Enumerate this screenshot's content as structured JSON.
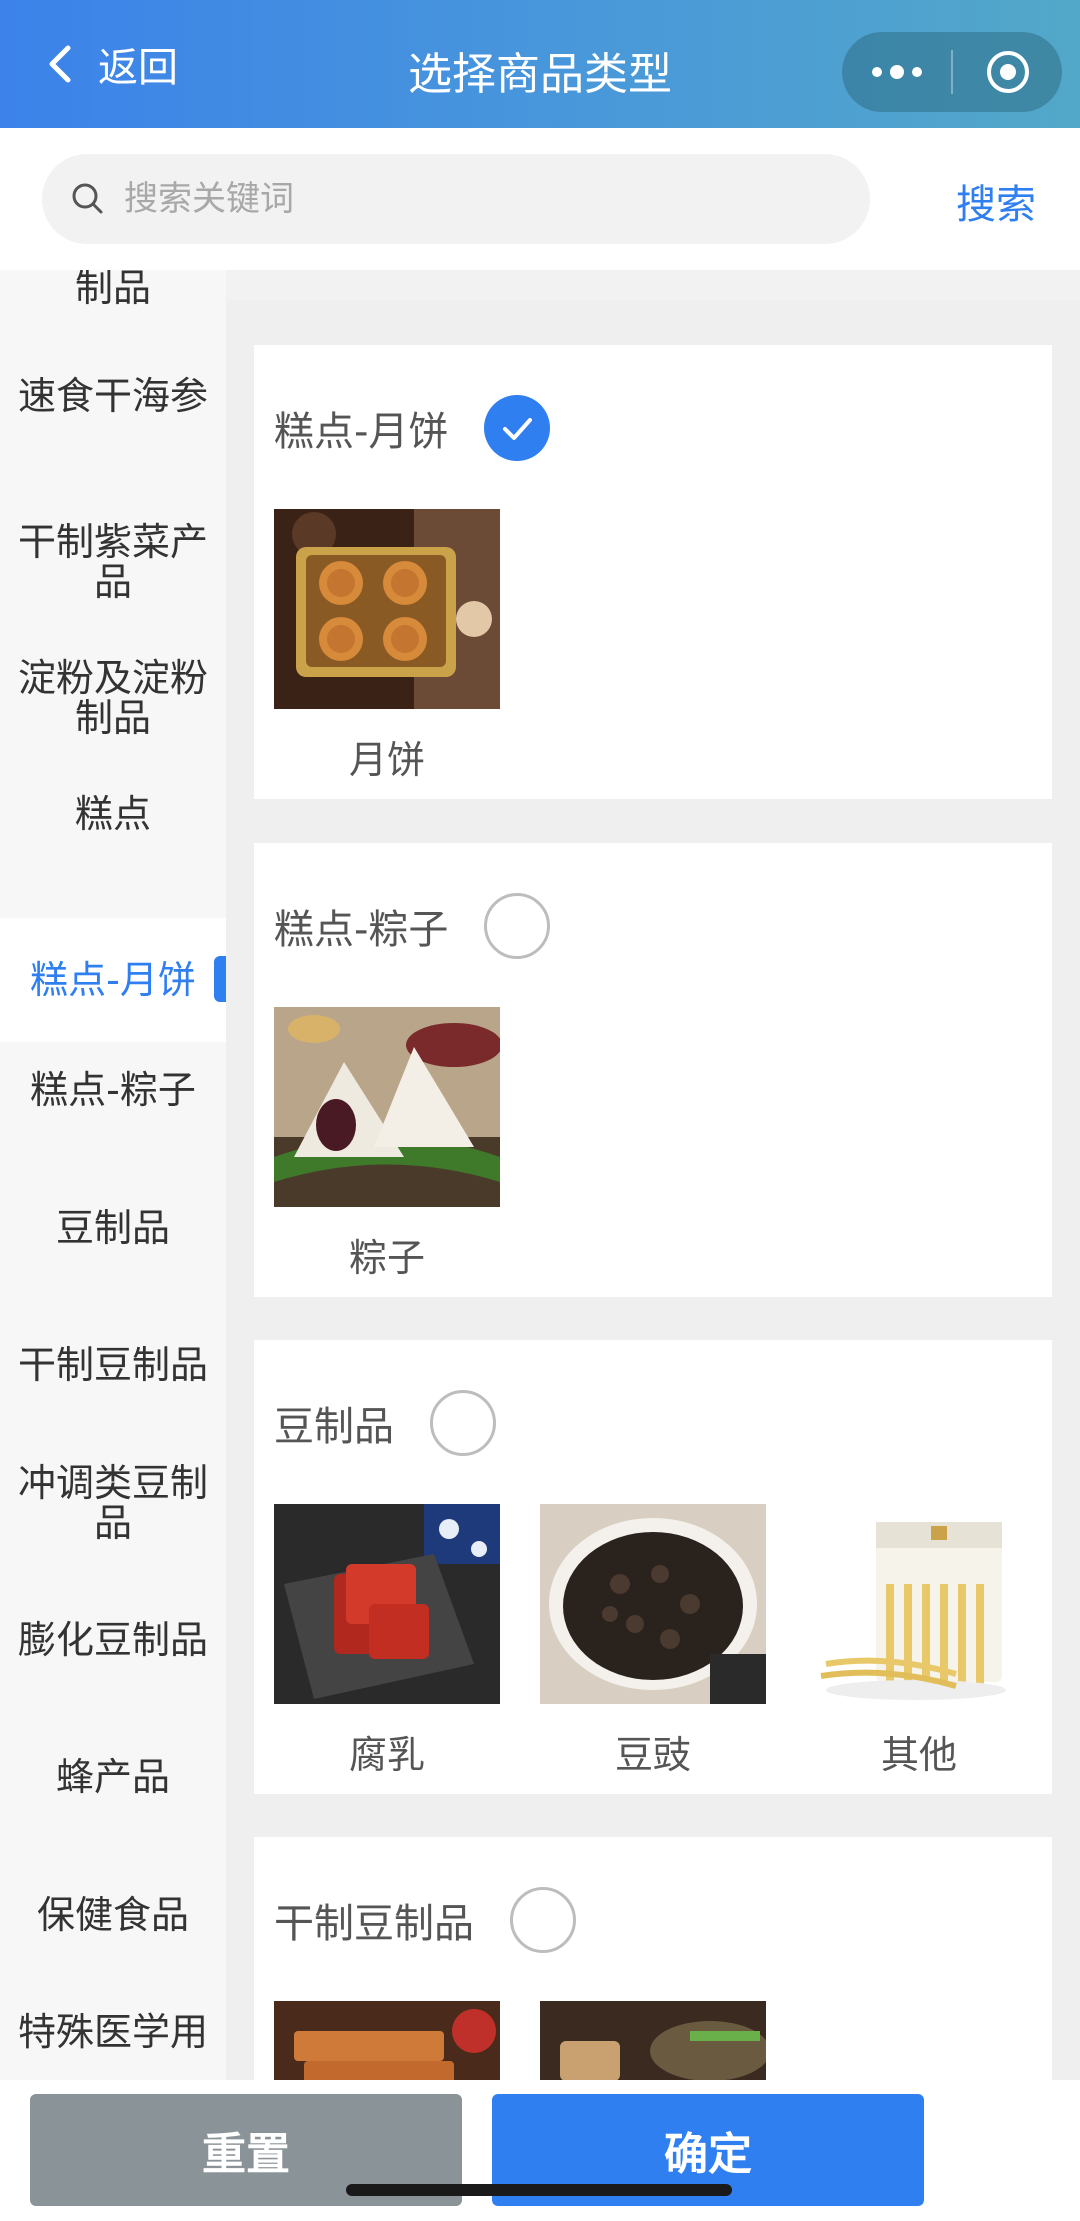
{
  "navbar": {
    "back_label": "返回",
    "title": "选择商品类型"
  },
  "search": {
    "placeholder": "搜索关键词",
    "button_label": "搜索"
  },
  "sidebar": {
    "items": [
      {
        "label": "制品",
        "active": false
      },
      {
        "label": "速食干海参",
        "active": false
      },
      {
        "label": "干制紫菜产品",
        "active": false
      },
      {
        "label": "淀粉及淀粉制品",
        "active": false
      },
      {
        "label": "糕点",
        "active": false
      },
      {
        "label": "糕点-月饼",
        "active": true
      },
      {
        "label": "糕点-粽子",
        "active": false
      },
      {
        "label": "豆制品",
        "active": false
      },
      {
        "label": "干制豆制品",
        "active": false
      },
      {
        "label": "冲调类豆制品",
        "active": false
      },
      {
        "label": "膨化豆制品",
        "active": false
      },
      {
        "label": "蜂产品",
        "active": false
      },
      {
        "label": "保健食品",
        "active": false
      },
      {
        "label": "特殊医学用",
        "active": false
      }
    ]
  },
  "categories": [
    {
      "title": "糕点-月饼",
      "checked": true,
      "products": [
        {
          "label": "月饼"
        }
      ]
    },
    {
      "title": "糕点-粽子",
      "checked": false,
      "products": [
        {
          "label": "粽子"
        }
      ]
    },
    {
      "title": "豆制品",
      "checked": false,
      "products": [
        {
          "label": "腐乳"
        },
        {
          "label": "豆豉"
        },
        {
          "label": "其他"
        }
      ]
    },
    {
      "title": "干制豆制品",
      "checked": false,
      "products": [
        {
          "label": ""
        },
        {
          "label": ""
        }
      ]
    }
  ],
  "bottom": {
    "reset_label": "重置",
    "confirm_label": "确定"
  },
  "colors": {
    "accent": "#2f7ff0",
    "reset": "#8a9398"
  }
}
